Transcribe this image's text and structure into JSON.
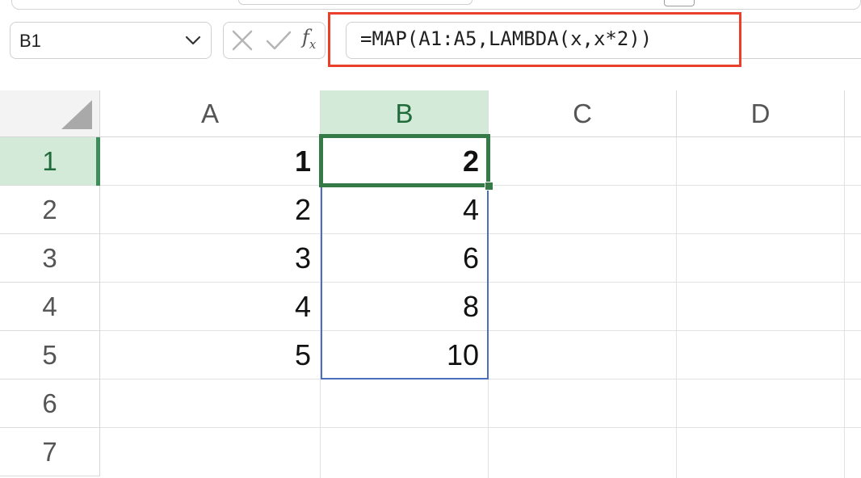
{
  "formula_bar": {
    "name_box": "B1",
    "name_box_icon": "chevron-down-icon",
    "cancel_icon": "close-icon",
    "enter_icon": "checkmark-icon",
    "function_icon": "function-icon",
    "fx_label": "f",
    "fx_sub": "x",
    "formula": "=MAP(A1:A5,LAMBDA(x,x*2))",
    "highlight_color": "#e8402a"
  },
  "grid": {
    "columns": [
      "A",
      "B",
      "C",
      "D"
    ],
    "rows": [
      "1",
      "2",
      "3",
      "4",
      "5",
      "6",
      "7"
    ],
    "selected_column": "B",
    "selected_row": "1",
    "column_a_values": [
      "1",
      "2",
      "3",
      "4",
      "5"
    ],
    "column_b_values": [
      "2",
      "4",
      "6",
      "8",
      "10"
    ],
    "selection_color": "#367a48",
    "spill_color": "#4a6fbf"
  }
}
